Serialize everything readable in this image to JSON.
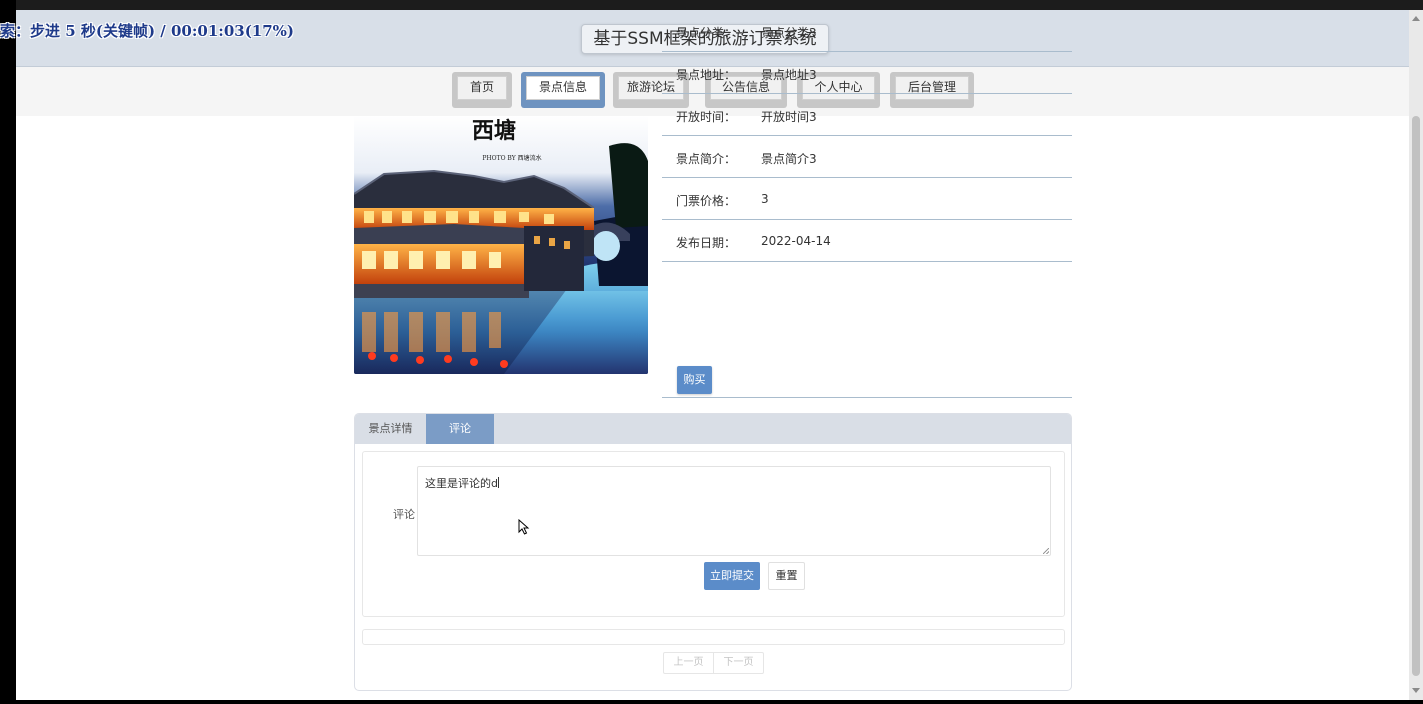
{
  "overlay_text": "索：步进 5 秒(关键帧) / 00:01:03(17%)",
  "site_title": "基于SSM框架的旅游订票系统",
  "nav": {
    "items": [
      "首页",
      "景点信息",
      "旅游论坛",
      "公告信息",
      "个人中心",
      "后台管理"
    ],
    "active": "景点信息"
  },
  "photo": {
    "alt": "西塘 night scene",
    "calligraphy": "西塘",
    "caption": "PHOTO BY 西塘流水"
  },
  "details": [
    {
      "label": "景点分类：",
      "value": "景点分类3"
    },
    {
      "label": "景点地址：",
      "value": "景点地址3"
    },
    {
      "label": "开放时间：",
      "value": "开放时间3"
    },
    {
      "label": "景点简介：",
      "value": "景点简介3"
    },
    {
      "label": "门票价格：",
      "value": "3"
    },
    {
      "label": "发布日期：",
      "value": "2022-04-14"
    }
  ],
  "buy_label": "购买",
  "tabs": [
    "景点详情",
    "评论"
  ],
  "active_tab": "评论",
  "comment": {
    "label": "评论",
    "value": "这里是评论的d",
    "submit_label": "立即提交",
    "reset_label": "重置"
  },
  "pager": {
    "prev": "上一页",
    "next": "下一页"
  },
  "colors": {
    "accent": "#5b8cc9",
    "tab_active": "#7b9cc6",
    "header_bg": "#d8dfe8"
  }
}
